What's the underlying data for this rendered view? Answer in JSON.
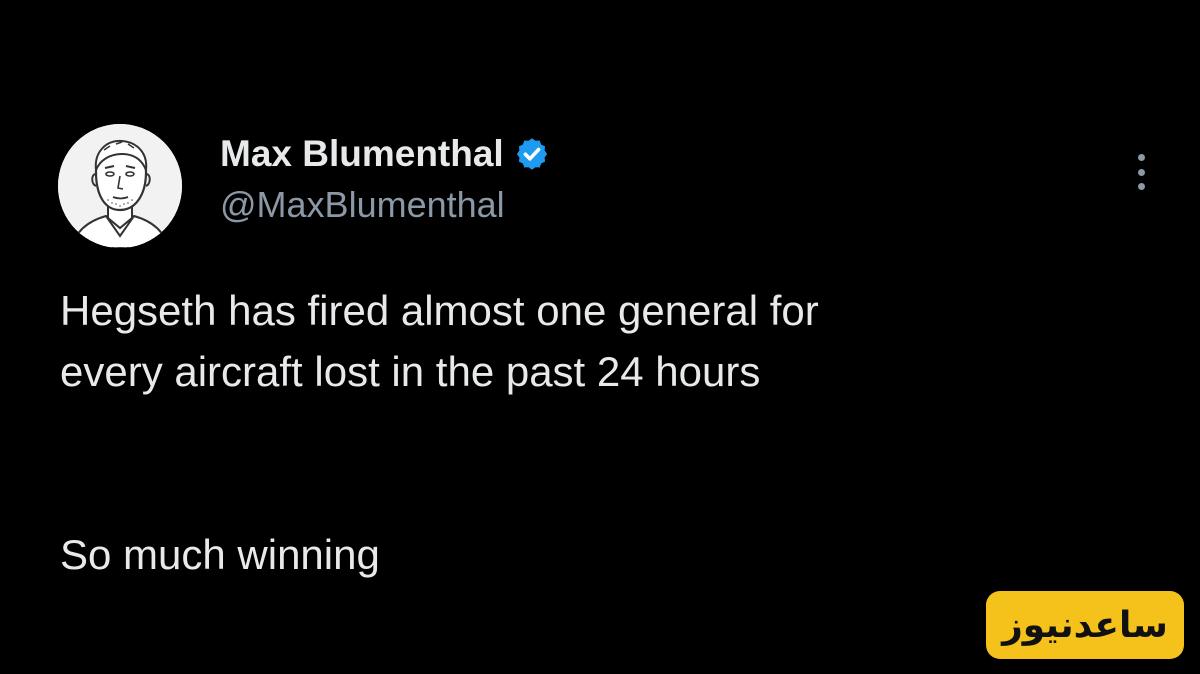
{
  "tweet": {
    "display_name": "Max Blumenthal",
    "handle": "@MaxBlumenthal",
    "verified": true,
    "lines_paragraph_1": [
      "Hegseth has fired almost one general for",
      "every aircraft lost in the past 24 hours"
    ],
    "paragraph_2": "So much winning"
  },
  "icons": {
    "avatar": "sketch-portrait-avatar",
    "verified": "verified-badge-icon",
    "more": "more-options-icon"
  },
  "watermark": {
    "text": "ساعدنیوز"
  },
  "colors": {
    "background": "#000000",
    "text": "#e7e9ea",
    "secondary_text": "#8b98a5",
    "verified_blue": "#1d9bf0",
    "watermark_yellow": "#f5c21b"
  }
}
